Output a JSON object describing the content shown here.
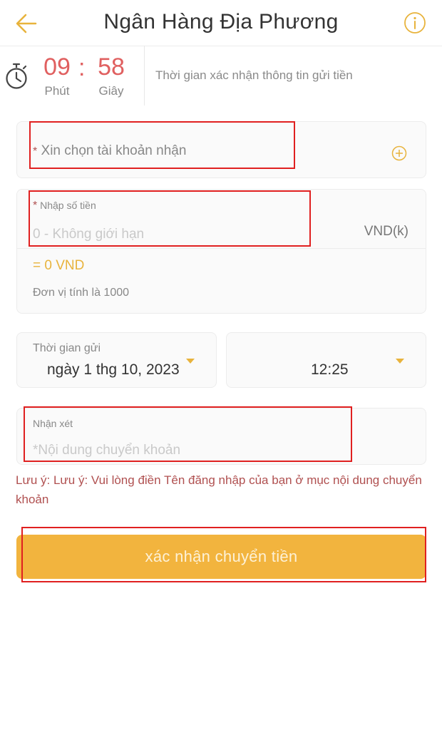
{
  "header": {
    "title": "Ngân Hàng Địa Phương",
    "back_icon": "arrow-left-icon",
    "info_icon": "info-icon"
  },
  "timer": {
    "minutes": "09",
    "separator": ":",
    "seconds": "58",
    "minutes_label": "Phút",
    "seconds_label": "Giây",
    "description": "Thời gian xác nhận thông tin gửi tiền"
  },
  "account": {
    "required_mark": "*",
    "placeholder": "Xin chọn tài khoản nhận"
  },
  "amount": {
    "required_mark": "*",
    "label": "Nhập số tiền",
    "placeholder": "0 - Không giới hạn",
    "unit": "VND(k)",
    "converted": "= 0 VND",
    "unit_note": "Đơn vị tính là 1000"
  },
  "deposit_time": {
    "label": "Thời gian gửi",
    "date": "ngày 1 thg 10, 2023",
    "time": "12:25"
  },
  "note": {
    "label": "Nhận xét",
    "placeholder": "*Nội dung chuyển khoản"
  },
  "warning": "Lưu ý: Lưu ý: Vui lòng điền Tên đăng nhập của bạn ở mục nội dung chuyển khoản",
  "submit_label": "xác nhận chuyển tiền",
  "colors": {
    "accent": "#f2b43e",
    "timer": "#e06060",
    "warning": "#b05050",
    "highlight": "#e02020"
  }
}
